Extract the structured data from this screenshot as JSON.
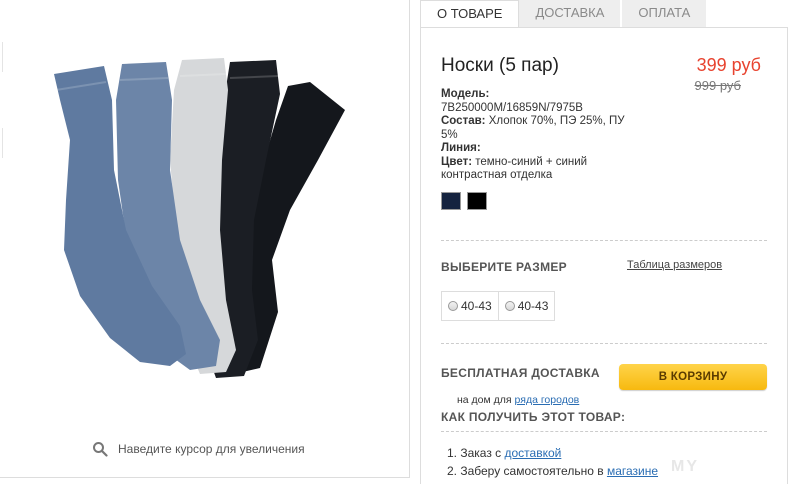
{
  "gallery": {
    "zoom_hint": "Наведите курсор для увеличения"
  },
  "tabs": [
    {
      "label": "О ТОВАРЕ",
      "active": true
    },
    {
      "label": "ДОСТАВКА",
      "active": false
    },
    {
      "label": "ОПЛАТА",
      "active": false
    }
  ],
  "product": {
    "title": "Носки (5 пар)",
    "price": "399 руб",
    "old_price": "999 руб",
    "model_label": "Модель:",
    "model_value": "7B250000M/16859N/7975B",
    "composition_label": "Состав:",
    "composition_value": "Хлопок 70%, ПЭ 25%, ПУ 5%",
    "line_label": "Линия:",
    "line_value": "",
    "color_label": "Цвет:",
    "color_value": "темно-синий + синий контрастная отделка",
    "swatches": [
      {
        "name": "navy",
        "color": "#15233f",
        "selected": true
      },
      {
        "name": "black",
        "color": "#000000",
        "selected": false
      }
    ]
  },
  "size": {
    "heading": "ВЫБЕРИТЕ РАЗМЕР",
    "table_link": "Таблица размеров",
    "options": [
      "40-43",
      "40-43"
    ]
  },
  "shipping": {
    "free_label": "БЕСПЛАТНАЯ ДОСТАВКА",
    "cart_button": "В КОРЗИНУ",
    "note_prefix": "на дом для",
    "note_link": "ряда городов"
  },
  "howto": {
    "heading": "КАК ПОЛУЧИТЬ ЭТОТ ТОВАР:",
    "step1_prefix": "1. Заказ с",
    "step1_link": "доставкой",
    "step2_prefix": "2. Заберу самостоятельно в",
    "step2_link": "магазине"
  },
  "watermark": "MY"
}
